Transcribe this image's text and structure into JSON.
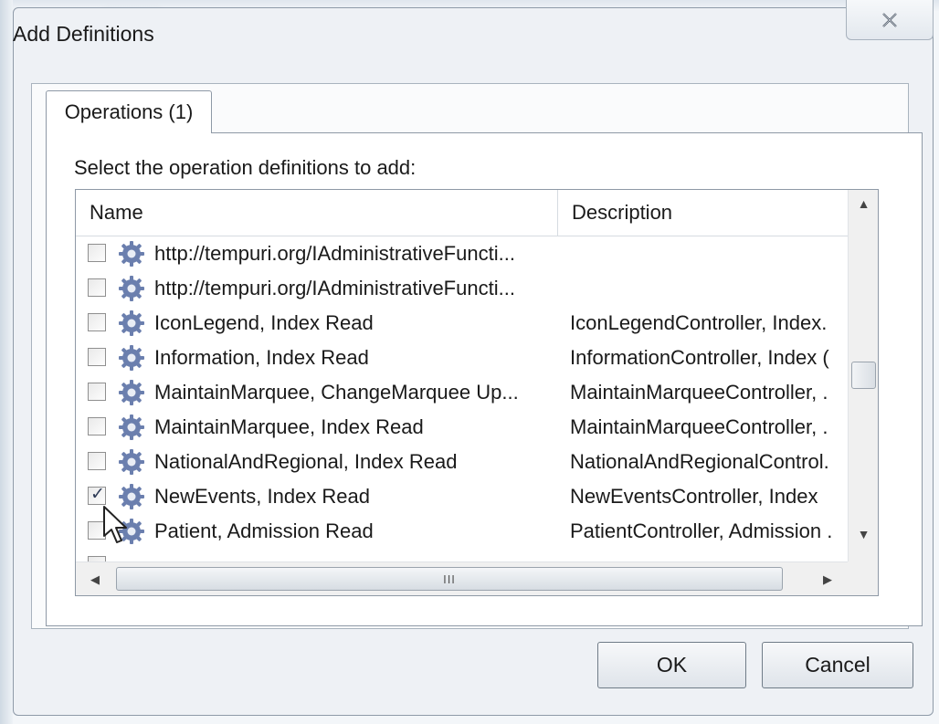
{
  "dialog": {
    "title": "Add Definitions",
    "close_icon": "close-icon"
  },
  "tab": {
    "label": "Operations (1)"
  },
  "instruction": "Select the operation definitions to add:",
  "list": {
    "columns": {
      "name": "Name",
      "description": "Description"
    },
    "rows": [
      {
        "checked": false,
        "icon": "gear-icon",
        "name": "http://tempuri.org/IAdministrativeFuncti...",
        "description": ""
      },
      {
        "checked": false,
        "icon": "gear-icon",
        "name": "http://tempuri.org/IAdministrativeFuncti...",
        "description": ""
      },
      {
        "checked": false,
        "icon": "gear-icon",
        "name": "IconLegend, Index Read",
        "description": "IconLegendController, Index."
      },
      {
        "checked": false,
        "icon": "gear-icon",
        "name": "Information, Index Read",
        "description": "InformationController, Index ("
      },
      {
        "checked": false,
        "icon": "gear-icon",
        "name": "MaintainMarquee, ChangeMarquee Up...",
        "description": "MaintainMarqueeController, ."
      },
      {
        "checked": false,
        "icon": "gear-icon",
        "name": "MaintainMarquee, Index Read",
        "description": "MaintainMarqueeController, ."
      },
      {
        "checked": false,
        "icon": "gear-icon",
        "name": "NationalAndRegional, Index Read",
        "description": "NationalAndRegionalControl."
      },
      {
        "checked": true,
        "icon": "gear-icon",
        "name": "NewEvents, Index Read",
        "description": "NewEventsController, Index"
      },
      {
        "checked": false,
        "icon": "gear-icon",
        "name": "Patient, Admission Read",
        "description": "PatientController, Admission ."
      }
    ],
    "hscroll_grip": "III"
  },
  "buttons": {
    "ok": "OK",
    "cancel": "Cancel"
  },
  "colors": {
    "gear": "#6b7fae",
    "background": "#eef1f5"
  }
}
